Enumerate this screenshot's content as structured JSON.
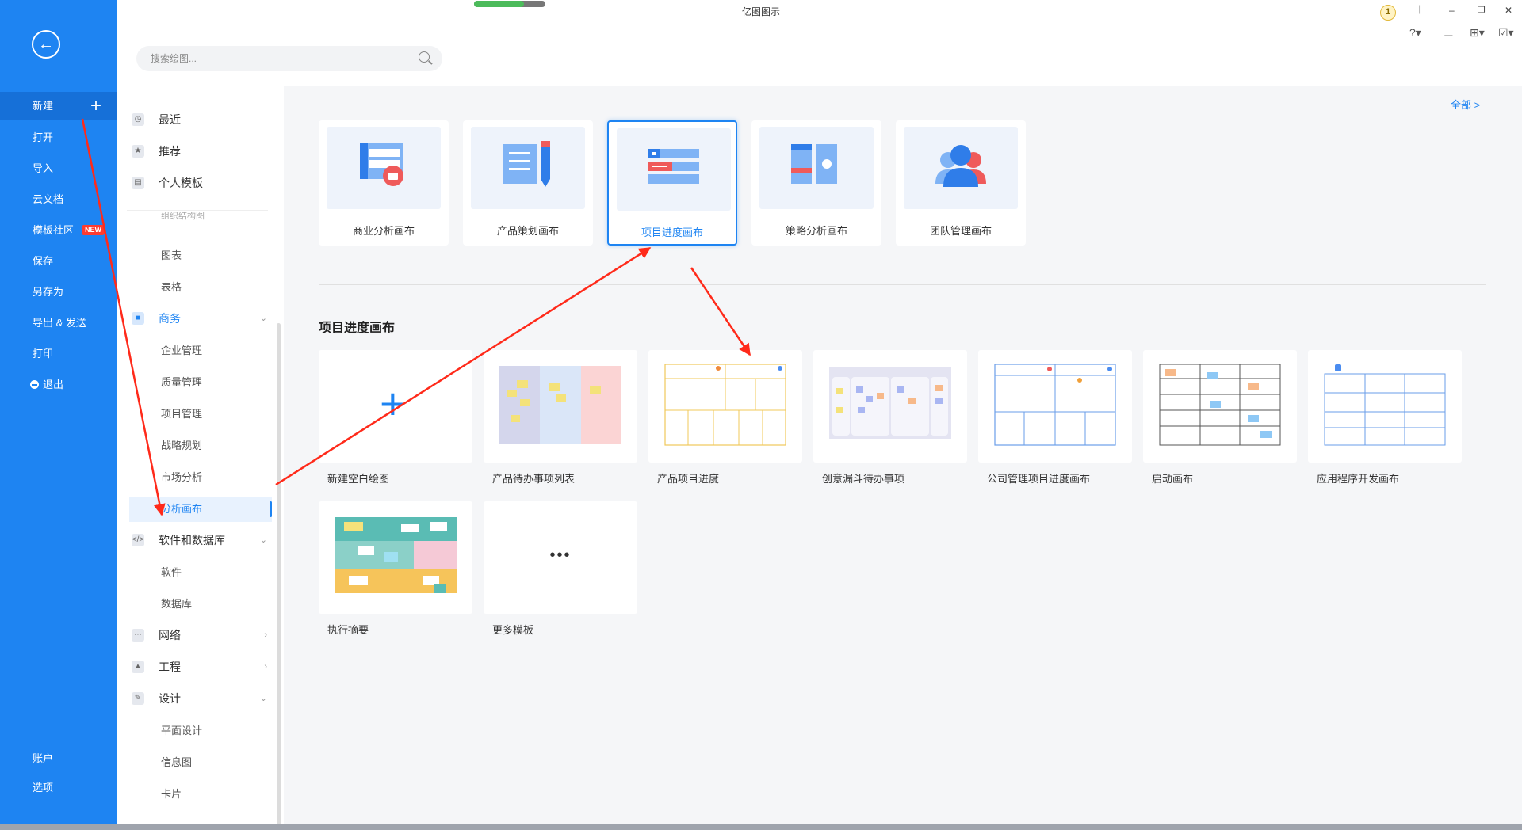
{
  "app": {
    "title": "亿图图示",
    "sync_progress": 0.7
  },
  "search": {
    "placeholder": "搜索绘图..."
  },
  "sidebar": {
    "items": [
      {
        "label": "新建"
      },
      {
        "label": "打开"
      },
      {
        "label": "导入"
      },
      {
        "label": "云文档"
      },
      {
        "label": "模板社区",
        "badge": "NEW"
      },
      {
        "label": "保存"
      },
      {
        "label": "另存为"
      },
      {
        "label": "导出 & 发送"
      },
      {
        "label": "打印"
      },
      {
        "label": "退出"
      }
    ],
    "bottom": [
      {
        "label": "账户"
      },
      {
        "label": "选项"
      }
    ]
  },
  "header": {
    "user_level": "1"
  },
  "categories": {
    "top": [
      {
        "label": "最近"
      },
      {
        "label": "推荐"
      },
      {
        "label": "个人模板"
      }
    ],
    "partial": "组织结构图",
    "general_sub": [
      {
        "label": "图表"
      },
      {
        "label": "表格"
      }
    ],
    "business": {
      "label": "商务",
      "sub": [
        "企业管理",
        "质量管理",
        "项目管理",
        "战略规划",
        "市场分析",
        "分析画布"
      ]
    },
    "software": {
      "label": "软件和数据库",
      "sub": [
        "软件",
        "数据库"
      ]
    },
    "network": {
      "label": "网络"
    },
    "engineering": {
      "label": "工程"
    },
    "design": {
      "label": "设计",
      "sub": [
        "平面设计",
        "信息图",
        "卡片"
      ]
    }
  },
  "main": {
    "all_link": "全部 >",
    "top_cards": [
      {
        "label": "商业分析画布"
      },
      {
        "label": "产品策划画布"
      },
      {
        "label": "项目进度画布"
      },
      {
        "label": "策略分析画布"
      },
      {
        "label": "团队管理画布"
      }
    ],
    "section_title": "项目进度画布",
    "templates": [
      {
        "label": "新建空白绘图"
      },
      {
        "label": "产品待办事项列表"
      },
      {
        "label": "产品项目进度"
      },
      {
        "label": "创意漏斗待办事项"
      },
      {
        "label": "公司管理项目进度画布"
      },
      {
        "label": "启动画布"
      },
      {
        "label": "应用程序开发画布"
      },
      {
        "label": "执行摘要"
      },
      {
        "label": "更多模板"
      }
    ],
    "more_glyph": "•••"
  },
  "colors": {
    "sidebar": "#1e84f2",
    "accent": "#1e84f2",
    "annotation": "#ff2a1a"
  }
}
